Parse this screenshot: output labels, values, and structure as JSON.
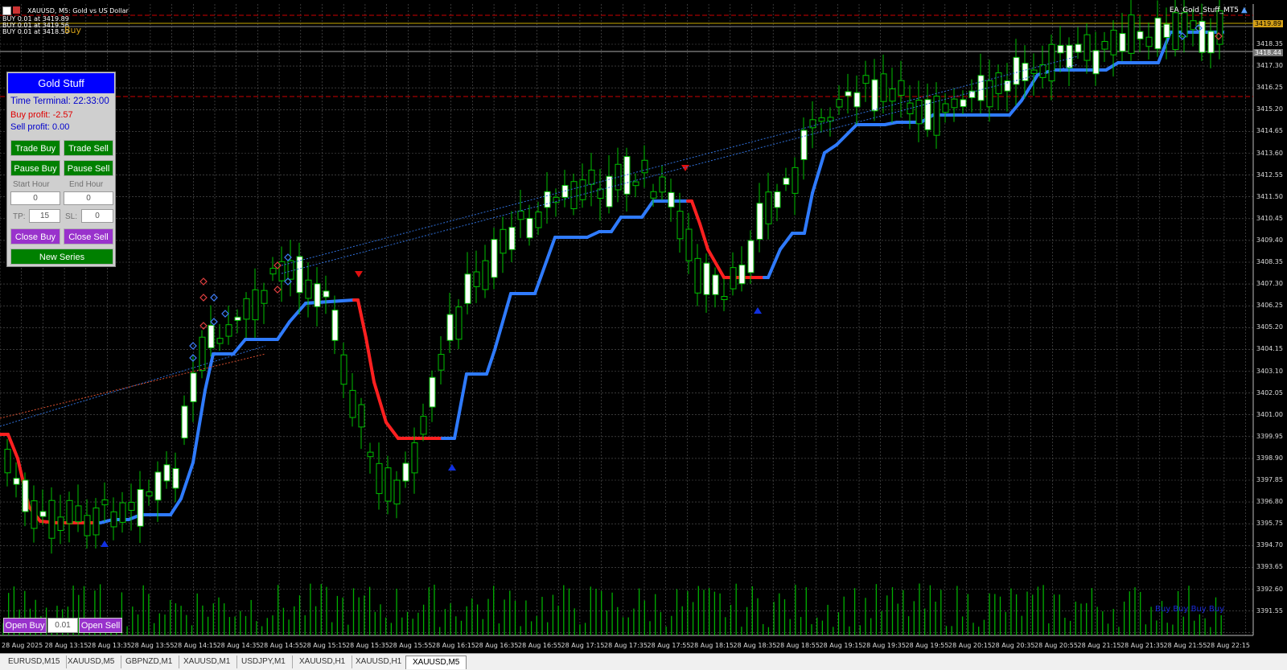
{
  "header": {
    "symbol_line": "XAUUSD, M5:  Gold vs US Dollar",
    "trades": [
      "BUY 0.01 at 3419.89",
      "BUY 0.01 at 3419.56",
      "BUY 0.01 at 3418.50"
    ],
    "overlay_label": "Buy",
    "ea_name": "EA_Gold_Stuff_MT5"
  },
  "panel": {
    "title": "Gold Stuff",
    "time_terminal": "Time Terminal: 22:33:00",
    "buy_profit": "Buy profit: -2.57",
    "sell_profit": "Sell profit: 0.00",
    "trade_buy": "Trade Buy",
    "trade_sell": "Trade Sell",
    "pause_buy": "Pause Buy",
    "pause_sell": "Pause Sell",
    "start_hour_label": "Start Hour",
    "end_hour_label": "End Hour",
    "start_hour_value": "0",
    "end_hour_value": "0",
    "tp_label": "TP:",
    "tp_value": "15",
    "sl_label": "SL:",
    "sl_value": "0",
    "close_buy": "Close Buy",
    "close_sell": "Close Sell",
    "new_series": "New Series"
  },
  "quick_trade": {
    "open_buy": "Open Buy",
    "lot_value": "0.01",
    "open_sell": "Open Sell"
  },
  "price_axis": {
    "labels": [
      "3418.35",
      "3417.30",
      "3416.25",
      "3415.20",
      "3414.65",
      "3413.60",
      "3412.55",
      "3411.50",
      "3410.45",
      "3409.40",
      "3408.35",
      "3407.30",
      "3406.25",
      "3405.20",
      "3404.15",
      "3403.10",
      "3402.05",
      "3401.00",
      "3399.95",
      "3398.90",
      "3397.85",
      "3396.80",
      "3395.75",
      "3394.70",
      "3393.65",
      "3392.60",
      "3391.55"
    ],
    "current_bid": "3419.89",
    "current_ask": "3418.44"
  },
  "time_axis": {
    "labels": [
      "28 Aug 2025",
      "28 Aug 13:15",
      "28 Aug 13:35",
      "28 Aug 13:55",
      "28 Aug 14:15",
      "28 Aug 14:35",
      "28 Aug 14:55",
      "28 Aug 15:15",
      "28 Aug 15:35",
      "28 Aug 15:55",
      "28 Aug 16:15",
      "28 Aug 16:35",
      "28 Aug 16:55",
      "28 Aug 17:15",
      "28 Aug 17:35",
      "28 Aug 17:55",
      "28 Aug 18:15",
      "28 Aug 18:35",
      "28 Aug 18:55",
      "28 Aug 19:15",
      "28 Aug 19:35",
      "28 Aug 19:55",
      "28 Aug 20:15",
      "28 Aug 20:35",
      "28 Aug 20:55",
      "28 Aug 21:15",
      "28 Aug 21:35",
      "28 Aug 21:55",
      "28 Aug 22:15"
    ]
  },
  "bottom_right_text": "Buy Buy Buy Buy",
  "tabs": [
    "EURUSD,M15",
    "XAUUSD,M5",
    "GBPNZD,M1",
    "XAUUSD,M1",
    "USDJPY,M1",
    "XAUUSD,H1",
    "XAUUSD,H1",
    "XAUUSD,M5"
  ],
  "active_tab_index": 7,
  "colors": {
    "bull_candle": "#ffffff",
    "wick": "#00c000",
    "trend_up": "#2f7bff",
    "trend_down": "#ff2020",
    "volume": "#00b000",
    "grid": "#5a5a5a"
  }
}
